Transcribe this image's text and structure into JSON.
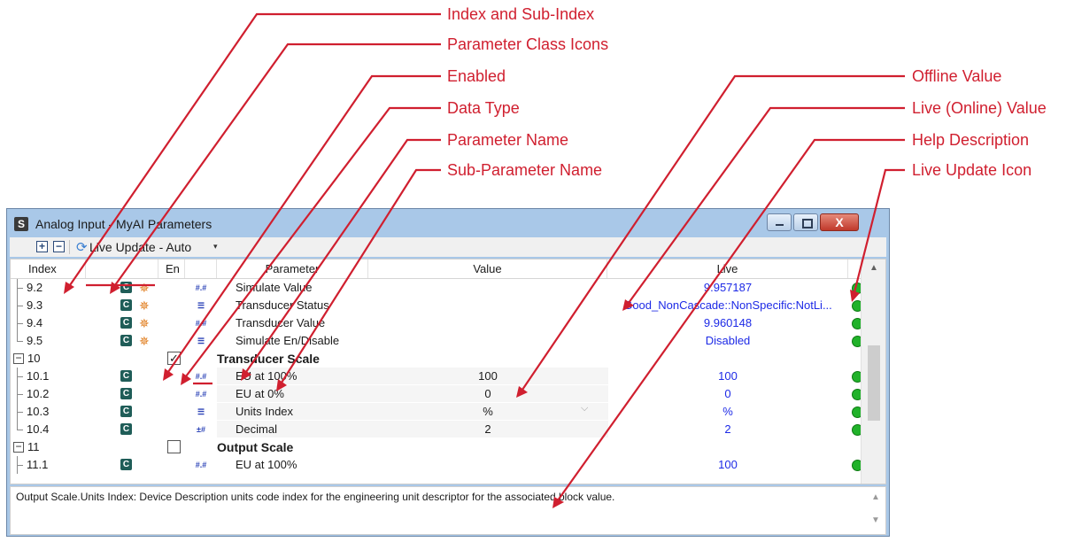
{
  "callouts": [
    "Index and Sub-Index",
    "Parameter Class Icons",
    "Enabled",
    "Data Type",
    "Parameter Name",
    "Sub-Parameter Name",
    "Offline Value",
    "Live (Online) Value",
    "Help Description",
    "Live Update Icon"
  ],
  "callout_color": "#d01f2f",
  "window": {
    "title": "Analog Input -  MyAI Parameters",
    "app_icon": "S",
    "close_label": "X"
  },
  "toolbar": {
    "expand_icon": "+",
    "collapse_icon": "−",
    "live_update": "Live Update - Auto",
    "caret": "▾"
  },
  "columns": {
    "index": "Index",
    "en": "En",
    "parameter": "Parameter",
    "value": "Value",
    "live": "Live"
  },
  "rows": [
    {
      "index": "9.2",
      "class": "C",
      "atom": true,
      "dtype": "#.#",
      "name": "Simulate Value",
      "value": "",
      "live": "9.957187"
    },
    {
      "index": "9.3",
      "class": "C",
      "atom": true,
      "dtype": "☰",
      "name": "Transducer Status",
      "value": "",
      "live": "Good_NonCascade::NonSpecific:NotLi..."
    },
    {
      "index": "9.4",
      "class": "C",
      "atom": true,
      "dtype": "#.#",
      "name": "Transducer Value",
      "value": "",
      "live": "9.960148"
    },
    {
      "index": "9.5",
      "class": "C",
      "atom": true,
      "dtype": "☰",
      "name": "Simulate En/Disable",
      "value": "",
      "live": "Disabled"
    },
    {
      "index": "10",
      "group": true,
      "checked": true,
      "name": "Transducer Scale"
    },
    {
      "index": "10.1",
      "class": "C",
      "atom": false,
      "dtype": "#.#",
      "name": "EU at 100%",
      "value": "100",
      "live": "100"
    },
    {
      "index": "10.2",
      "class": "C",
      "atom": false,
      "dtype": "#.#",
      "name": "EU at 0%",
      "value": "0",
      "live": "0"
    },
    {
      "index": "10.3",
      "class": "C",
      "atom": false,
      "dtype": "☰",
      "name": "Units Index",
      "value": "%",
      "live": "%"
    },
    {
      "index": "10.4",
      "class": "C",
      "atom": false,
      "dtype": "±#",
      "name": "Decimal",
      "value": "2",
      "live": "2"
    },
    {
      "index": "11",
      "group": true,
      "checked": false,
      "name": "Output Scale"
    },
    {
      "index": "11.1",
      "class": "C",
      "atom": false,
      "dtype": "#.#",
      "name": "EU at 100%",
      "value": "",
      "live": "100"
    }
  ],
  "help_text": "Output Scale.Units Index: Device Description units code index for the engineering unit descriptor for the associated block value.",
  "glyphs": {
    "atom": "✵",
    "check": "✓",
    "minus": "−",
    "value_caret": "⌵",
    "scroll_up": "▲",
    "scroll_down": "▼"
  },
  "colors": {
    "live_text": "#1d2ae6",
    "live_icon": "#21b22a",
    "class_icon": "#1f5d58",
    "atom_icon": "#e07b1a"
  }
}
